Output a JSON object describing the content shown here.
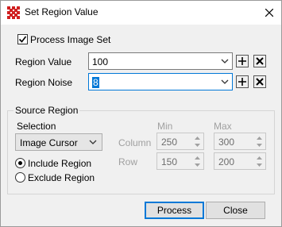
{
  "window": {
    "title": "Set Region Value"
  },
  "process_image_set": {
    "label": "Process Image Set",
    "checked": true
  },
  "region_value": {
    "label": "Region Value",
    "value": "100"
  },
  "region_noise": {
    "label": "Region Noise",
    "value": "8"
  },
  "source_region": {
    "title": "Source Region",
    "selection_label": "Selection",
    "selection_value": "Image Cursor",
    "min_header": "Min",
    "max_header": "Max",
    "column_label": "Column",
    "row_label": "Row",
    "column_min": "250",
    "column_max": "300",
    "row_min": "150",
    "row_max": "200",
    "include_label": "Include Region",
    "exclude_label": "Exclude Region",
    "mode": "include"
  },
  "buttons": {
    "process": "Process",
    "close": "Close"
  },
  "colors": {
    "accent": "#0078d7",
    "delete_x": "#000000",
    "app_icon": "#d02020"
  }
}
